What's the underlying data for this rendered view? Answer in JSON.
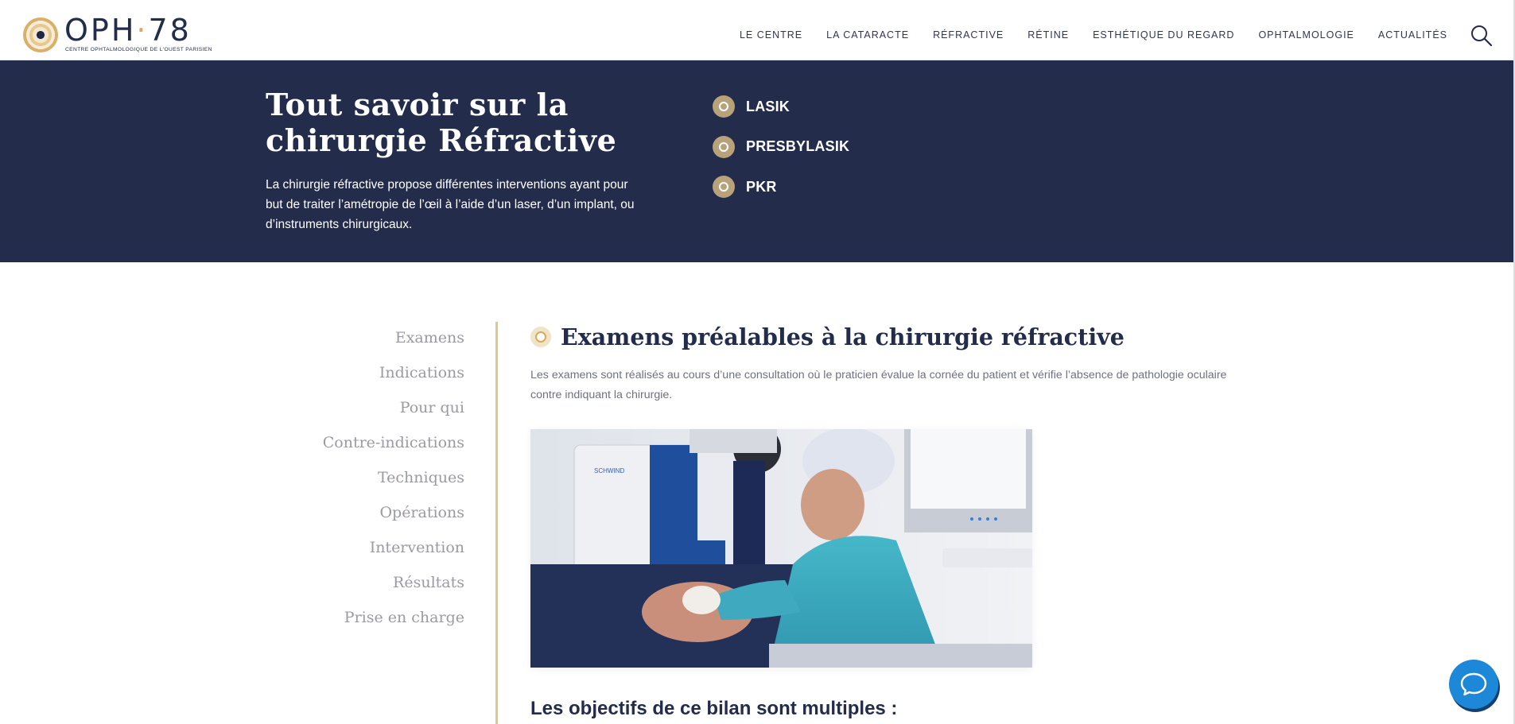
{
  "header": {
    "logo": {
      "brand": "OPH",
      "dot": "·",
      "number": "78",
      "subtitle": "CENTRE OPHTALMOLOGIQUE DE L'OUEST PARISIEN"
    },
    "nav": [
      {
        "label": "LE CENTRE"
      },
      {
        "label": "LA CATARACTE"
      },
      {
        "label": "RÉFRACTIVE"
      },
      {
        "label": "RÉTINE"
      },
      {
        "label": "ESTHÉTIQUE DU REGARD"
      },
      {
        "label": "OPHTALMOLOGIE"
      },
      {
        "label": "ACTUALITÉS"
      }
    ],
    "search_icon": "search-icon"
  },
  "hero": {
    "title": "Tout savoir sur la chirurgie Réfractive",
    "description": "La chirurgie réfractive propose différentes interventions ayant pour but de traiter l’amétropie de l’œil à l’aide d’un laser, d’un implant, ou d’instruments chirurgicaux.",
    "links": [
      {
        "label": "LASIK"
      },
      {
        "label": "PRESBYLASIK"
      },
      {
        "label": "PKR"
      }
    ]
  },
  "sidebar": {
    "items": [
      {
        "label": "Examens"
      },
      {
        "label": "Indications"
      },
      {
        "label": "Pour qui"
      },
      {
        "label": "Contre-indications"
      },
      {
        "label": "Techniques"
      },
      {
        "label": "Opérations"
      },
      {
        "label": "Intervention"
      },
      {
        "label": "Résultats"
      },
      {
        "label": "Prise en charge"
      }
    ]
  },
  "main": {
    "section_title": "Examens préalables à la chirurgie réfractive",
    "section_text": "Les examens sont réalisés au cours d’une consultation où le praticien évalue la cornée du patient et vérifie l’absence de pathologie oculaire contre indiquant la chirurgie.",
    "photo_brand": "SCHWIND",
    "objectifs_heading": "Les objectifs de ce bilan sont multiples :"
  },
  "colors": {
    "navy": "#242c4c",
    "gold": "#d7aa5f",
    "chat_blue": "#1e88d8"
  }
}
